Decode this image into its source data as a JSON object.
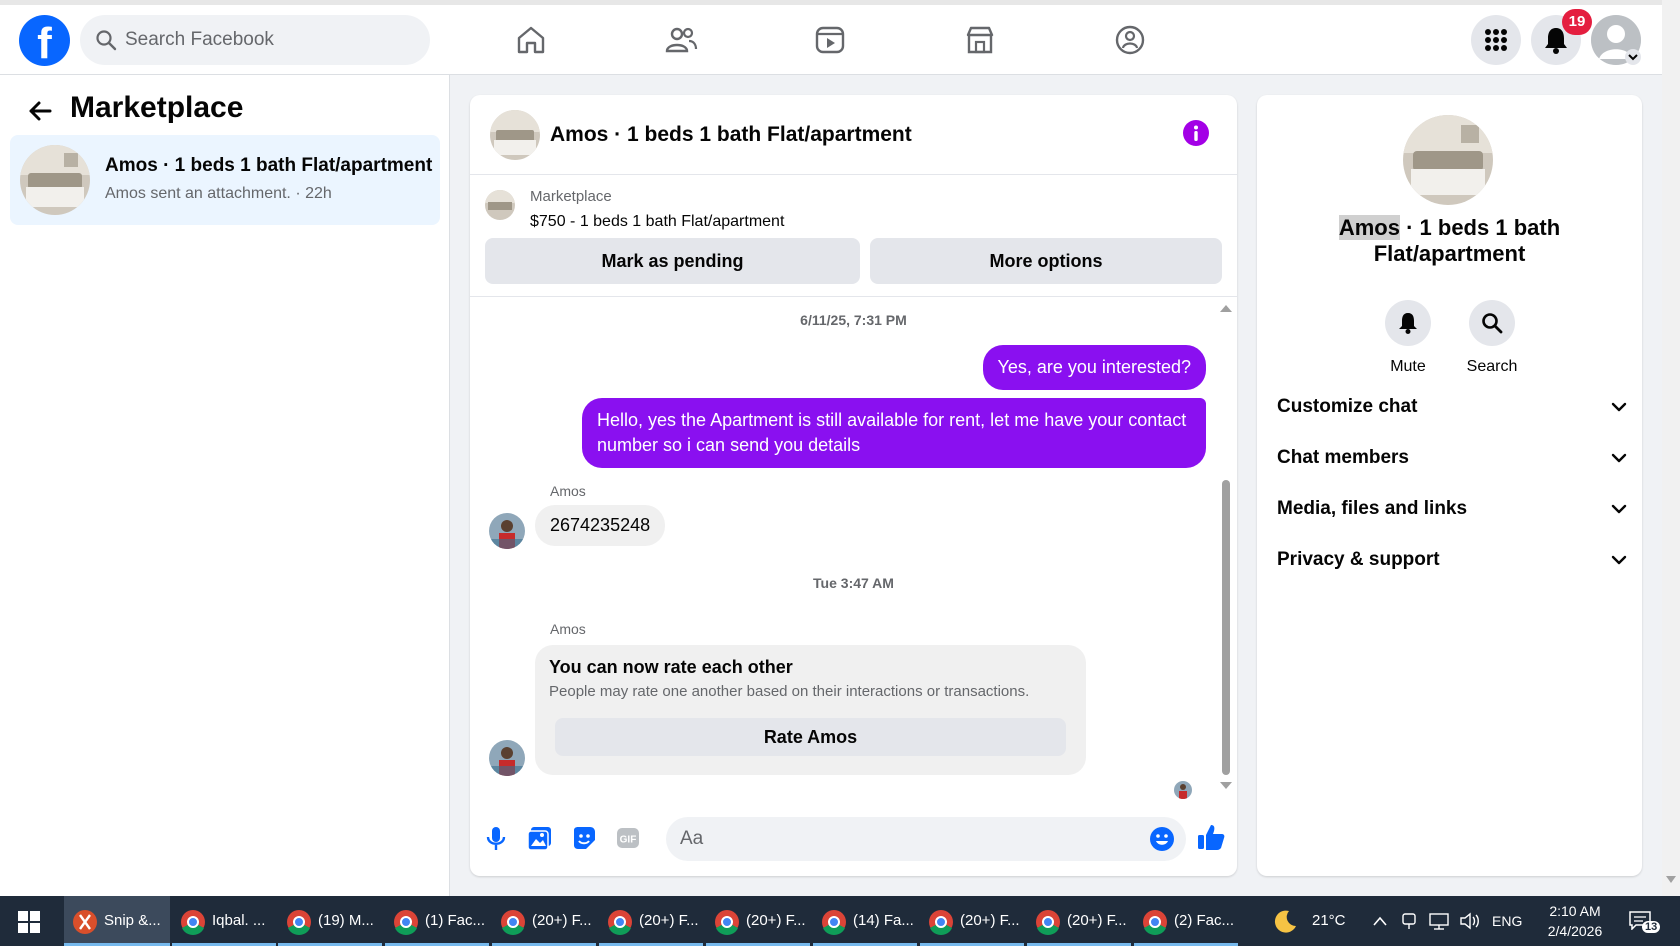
{
  "topbar": {
    "search_placeholder": "Search Facebook",
    "notification_count": "19",
    "nav_icons": [
      "home-icon",
      "friends-icon",
      "video-icon",
      "marketplace-icon",
      "groups-icon"
    ]
  },
  "left": {
    "title": "Marketplace",
    "thread": {
      "title": "Amos · 1 beds 1 bath Flat/apartment",
      "subtitle": "Amos sent an attachment. · 22h"
    }
  },
  "chat": {
    "header_name": "Amos · 1 beds 1 bath Flat/apartment",
    "listing_label": "Marketplace",
    "listing_detail": "$750 - 1 beds 1 bath Flat/apartment",
    "mark_pending": "Mark as pending",
    "more_options": "More options",
    "ts1": "6/11/25, 7:31 PM",
    "msg_out1": "Yes, are you interested?",
    "msg_out2": "Hello, yes the Apartment is still available for rent, let me have your contact number so i can send you details",
    "sender1": "Amos",
    "msg_in1": "2674235248",
    "ts2": "Tue 3:47 AM",
    "sender2": "Amos",
    "rate_title": "You can now rate each other",
    "rate_sub": "People may rate one another based on their interactions or transactions.",
    "rate_button": "Rate Amos",
    "composer_placeholder": "Aa"
  },
  "right": {
    "title_hl": "Amos",
    "title_rest": " · 1 beds 1 bath",
    "title_line2": "Flat/apartment",
    "mute": "Mute",
    "search": "Search",
    "rows": [
      "Customize chat",
      "Chat members",
      "Media, files and links",
      "Privacy & support"
    ]
  },
  "taskbar": {
    "items": [
      "Snip &...",
      "Iqbal. ...",
      "(19) M...",
      "(1) Fac...",
      "(20+) F...",
      "(20+) F...",
      "(20+) F...",
      "(14) Fa...",
      "(20+) F...",
      "(20+) F...",
      "(2) Fac..."
    ],
    "weather": "21°C",
    "lang": "ENG",
    "time": "2:10 AM",
    "date": "2/4/2026",
    "notif": "13"
  },
  "colors": {
    "accent": "#0866ff",
    "purple": "#8a10f0",
    "thread_bg": "#ebf5ff"
  }
}
